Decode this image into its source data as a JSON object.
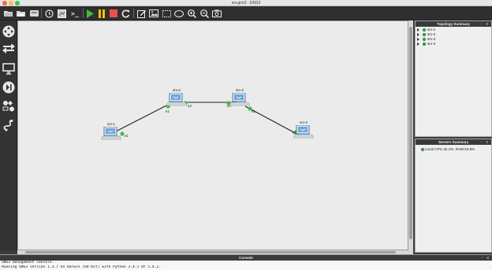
{
  "window": {
    "title": "srv.gns3 - GNS3",
    "traffic_colors": [
      "#fc605c",
      "#fdbc40",
      "#34c84a"
    ]
  },
  "toolbar": {
    "buttons": [
      {
        "name": "open-folder-icon"
      },
      {
        "name": "open-project-icon"
      },
      {
        "name": "save-icon"
      },
      {
        "name": "snapshot-clock-icon"
      },
      {
        "name": "show-interface-labels-icon"
      },
      {
        "name": "console-terminal-icon",
        "glyph": ">_"
      },
      {
        "name": "start-play-icon"
      },
      {
        "name": "suspend-pause-icon"
      },
      {
        "name": "stop-icon"
      },
      {
        "name": "reload-icon"
      },
      {
        "name": "edit-note-icon"
      },
      {
        "name": "insert-picture-icon"
      },
      {
        "name": "draw-rectangle-icon"
      },
      {
        "name": "draw-ellipse-icon"
      },
      {
        "name": "zoom-in-icon"
      },
      {
        "name": "zoom-out-icon"
      },
      {
        "name": "screenshot-camera-icon"
      }
    ]
  },
  "sidebar": {
    "items": [
      {
        "name": "routers-icon"
      },
      {
        "name": "switches-icon"
      },
      {
        "name": "end-devices-icon"
      },
      {
        "name": "security-devices-icon"
      },
      {
        "name": "all-devices-icon"
      },
      {
        "name": "add-link-icon"
      }
    ]
  },
  "canvas": {
    "nodes": [
      {
        "label": "srv-1"
      },
      {
        "label": "srv-2"
      },
      {
        "label": "srv-3"
      },
      {
        "label": "srv-4"
      }
    ],
    "ports": [
      "e1",
      "e1",
      "e2",
      "e2",
      "e1",
      "e1"
    ]
  },
  "topology_summary": {
    "title": "Topology Summary",
    "controls": "· ×",
    "items": [
      "srv-1",
      "srv-2",
      "srv-3",
      "srv-4"
    ]
  },
  "servers_summary": {
    "title": "Servers Summary",
    "controls": "· ×",
    "server": "Local CPU 32.1%, RAM 62.8%"
  },
  "console": {
    "title": "Console",
    "controls": "· ×",
    "lines": [
      "GNS3 management console.",
      "Running GNS3 version 1.3.7 on Darwin (64-bit) with Python 3.4.1 Qt 5.4.2."
    ]
  }
}
